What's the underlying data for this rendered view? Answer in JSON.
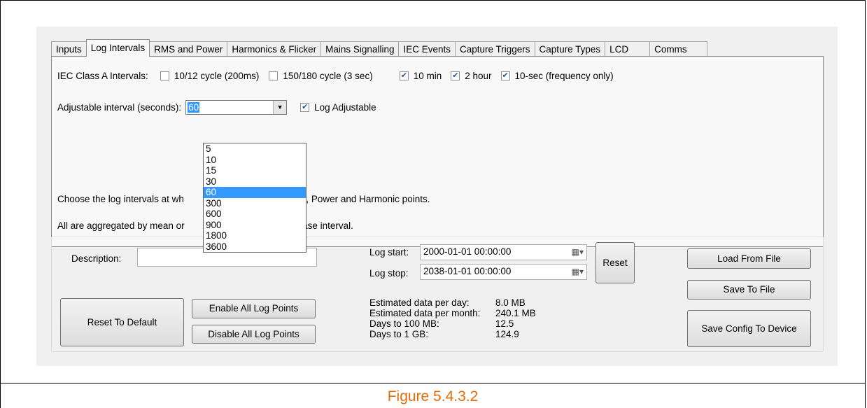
{
  "tabs": [
    "Inputs",
    "Log Intervals",
    "RMS and Power",
    "Harmonics & Flicker",
    "Mains Signalling",
    "IEC Events",
    "Capture Triggers",
    "Capture Types",
    "LCD",
    "Comms"
  ],
  "log_intervals": {
    "iec_label": "IEC Class A Intervals:",
    "checkboxes": [
      {
        "label": "10/12 cycle (200ms)",
        "checked": false
      },
      {
        "label": "150/180 cycle (3 sec)",
        "checked": false
      },
      {
        "label": "10 min",
        "checked": true
      },
      {
        "label": "2 hour",
        "checked": true
      },
      {
        "label": "10-sec (frequency only)",
        "checked": true
      }
    ],
    "adjustable_label": "Adjustable interval (seconds):",
    "adjustable_value": "60",
    "log_adjustable_label": "Log Adjustable",
    "log_adjustable_checked": true,
    "help_line1_a": "Choose the log intervals at wh",
    "help_line1_b": "ted RMS, Power and Harmonic points.",
    "help_line2_a": "All are aggregated by mean or",
    "help_line2_b": "base interval.",
    "dropdown_options": [
      "5",
      "10",
      "15",
      "30",
      "60",
      "300",
      "600",
      "900",
      "1800",
      "3600"
    ],
    "dropdown_selected": "60"
  },
  "bottom": {
    "description_label": "Description:",
    "description_value": "",
    "log_start_label": "Log start:",
    "log_start_value": "2000-01-01 00:00:00",
    "log_stop_label": "Log stop:",
    "log_stop_value": "2038-01-01 00:00:00",
    "reset_label": "Reset",
    "load_label": "Load From File",
    "save_label": "Save To File",
    "save_config_label": "Save Config To Device",
    "reset_default_label": "Reset To Default",
    "enable_all_label": "Enable All Log Points",
    "disable_all_label": "Disable All Log Points",
    "stats": [
      {
        "key": "Estimated data per day:",
        "value": "8.0 MB"
      },
      {
        "key": "Estimated data per month:",
        "value": "240.1 MB"
      },
      {
        "key": "Days to 100 MB:",
        "value": "12.5"
      },
      {
        "key": "Days to 1 GB:",
        "value": "124.9"
      }
    ]
  },
  "caption": "Figure 5.4.3.2"
}
